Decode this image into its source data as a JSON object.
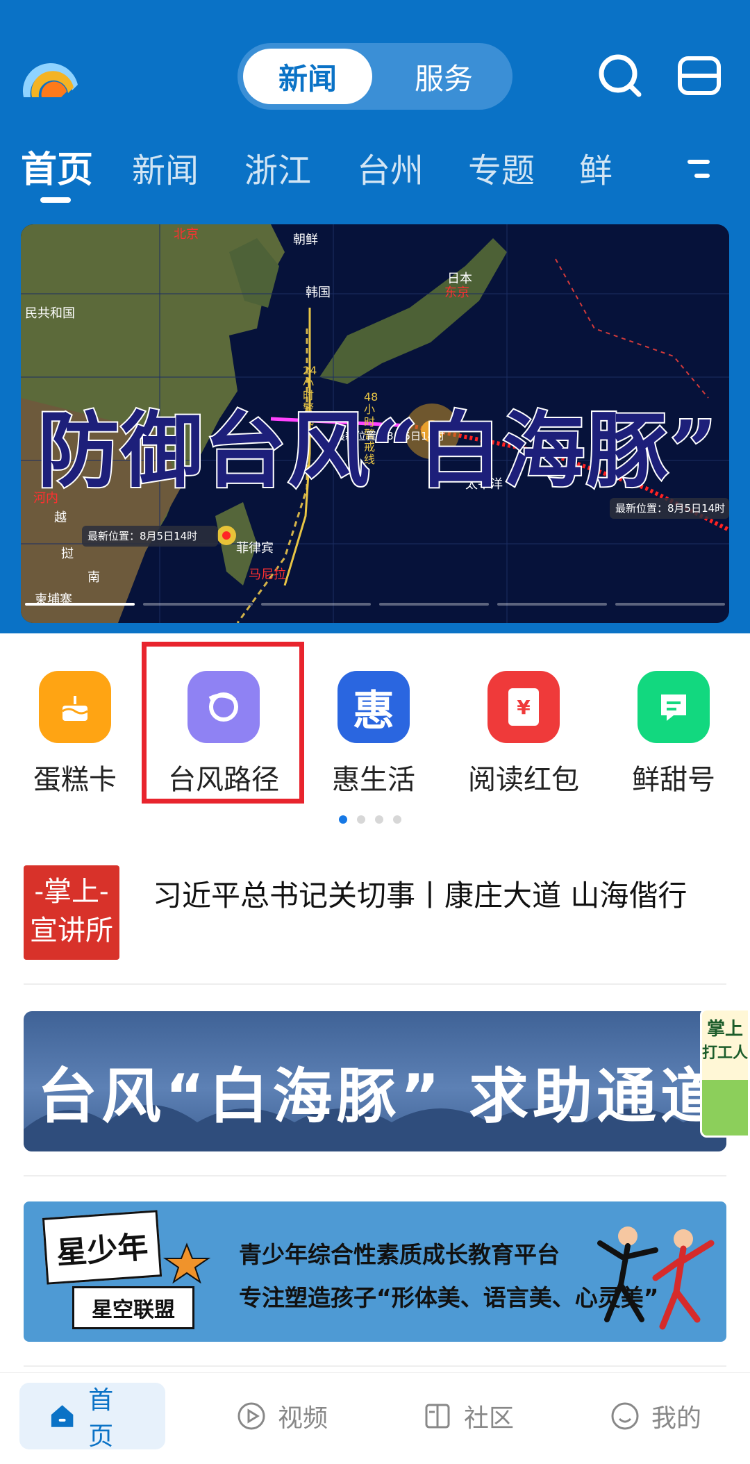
{
  "header": {
    "segment_active": "新闻",
    "segment_inactive": "服务"
  },
  "channel_tabs": [
    "首页",
    "新闻",
    "浙江",
    "台州",
    "专题",
    "鲜"
  ],
  "banner": {
    "headline": "防御台风“白海豚”",
    "map_labels": [
      "北京",
      "朝鲜",
      "韩国",
      "日本",
      "东京",
      "民共和国",
      "河内",
      "越",
      "挝",
      "南",
      "柬埔寨",
      "菲律宾",
      "马尼拉",
      "太平洋",
      "48小时警戒线",
      "24小时警戒线",
      "最新位置：8月5日14时",
      "最新位置：8月5日14时",
      "最新位置：8月5日14时"
    ]
  },
  "quick_links": [
    {
      "label": "蛋糕卡",
      "icon": "cake-icon",
      "color": "#ffa413"
    },
    {
      "label": "台风路径",
      "icon": "typhoon-icon",
      "color": "#8f82f3"
    },
    {
      "label": "惠生活",
      "icon": "hui-icon",
      "color": "#2a66e0",
      "glyph": "惠"
    },
    {
      "label": "阅读红包",
      "icon": "red-envelope-icon",
      "color": "#ef3a3a",
      "glyph": "¥"
    },
    {
      "label": "鲜甜号",
      "icon": "message-icon",
      "color": "#12d87f"
    }
  ],
  "highlight_color": "#e8242d",
  "news": [
    {
      "thumb_line1": "-掌上-",
      "thumb_line2": "宣讲所",
      "title": "习近平总书记关切事丨康庄大道 山海偕行"
    }
  ],
  "promo_banner": {
    "text": "台风“白海豚” 求助通道"
  },
  "float_ad": {
    "line1": "掌上",
    "line2": "打工人"
  },
  "ad_banner": {
    "logo_line1": "星少年",
    "logo_line2": "星空联盟",
    "line1": "青少年综合性素质成长教育平台",
    "line2": "专注塑造孩子“形体美、语言美、心灵美”"
  },
  "bottom_nav": [
    {
      "label": "首页",
      "icon": "home-icon",
      "active": true
    },
    {
      "label": "视频",
      "icon": "video-icon",
      "active": false
    },
    {
      "label": "社区",
      "icon": "community-icon",
      "active": false
    },
    {
      "label": "我的",
      "icon": "profile-icon",
      "active": false
    }
  ],
  "colors": {
    "brand": "#0a72c6",
    "accent_active_dot": "#1678e5"
  }
}
